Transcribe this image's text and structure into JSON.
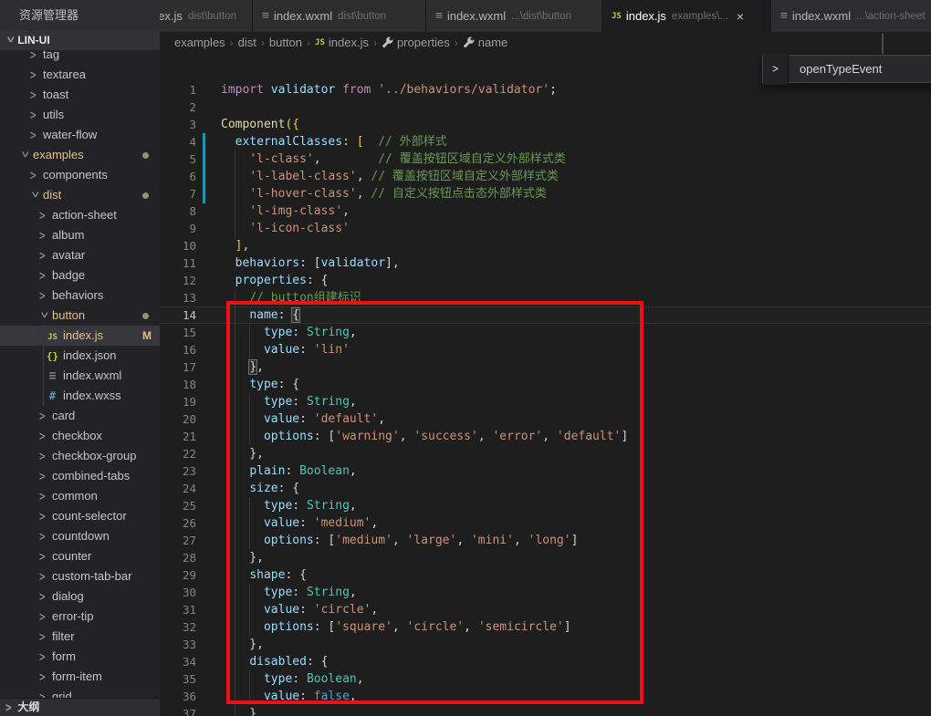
{
  "explorer": {
    "title": "资源管理器",
    "root": "LIN-UI",
    "outline": "大纲",
    "items": [
      {
        "k": "folder",
        "lvl": 2,
        "label": "tag"
      },
      {
        "k": "folder",
        "lvl": 2,
        "label": "textarea"
      },
      {
        "k": "folder",
        "lvl": 2,
        "label": "toast"
      },
      {
        "k": "folder",
        "lvl": 2,
        "label": "utils"
      },
      {
        "k": "folder",
        "lvl": 2,
        "label": "water-flow"
      },
      {
        "k": "folder",
        "lvl": 1,
        "label": "examples",
        "open": true,
        "dot": true,
        "mod": true
      },
      {
        "k": "folder",
        "lvl": 2,
        "label": "components"
      },
      {
        "k": "folder",
        "lvl": 2,
        "label": "dist",
        "open": true,
        "dot": true,
        "mod": true
      },
      {
        "k": "folder",
        "lvl": 3,
        "label": "action-sheet"
      },
      {
        "k": "folder",
        "lvl": 3,
        "label": "album"
      },
      {
        "k": "folder",
        "lvl": 3,
        "label": "avatar"
      },
      {
        "k": "folder",
        "lvl": 3,
        "label": "badge"
      },
      {
        "k": "folder",
        "lvl": 3,
        "label": "behaviors"
      },
      {
        "k": "folder",
        "lvl": 3,
        "label": "button",
        "open": true,
        "dot": true,
        "mod": true
      },
      {
        "k": "file",
        "lvl": 4,
        "icon": "js",
        "label": "index.js",
        "sel": true,
        "badge": "M",
        "mod": true
      },
      {
        "k": "file",
        "lvl": 4,
        "icon": "json",
        "label": "index.json"
      },
      {
        "k": "file",
        "lvl": 4,
        "icon": "wxml",
        "label": "index.wxml"
      },
      {
        "k": "file",
        "lvl": 4,
        "icon": "wxss",
        "label": "index.wxss"
      },
      {
        "k": "folder",
        "lvl": 3,
        "label": "card"
      },
      {
        "k": "folder",
        "lvl": 3,
        "label": "checkbox"
      },
      {
        "k": "folder",
        "lvl": 3,
        "label": "checkbox-group"
      },
      {
        "k": "folder",
        "lvl": 3,
        "label": "combined-tabs"
      },
      {
        "k": "folder",
        "lvl": 3,
        "label": "common"
      },
      {
        "k": "folder",
        "lvl": 3,
        "label": "count-selector"
      },
      {
        "k": "folder",
        "lvl": 3,
        "label": "countdown"
      },
      {
        "k": "folder",
        "lvl": 3,
        "label": "counter"
      },
      {
        "k": "folder",
        "lvl": 3,
        "label": "custom-tab-bar"
      },
      {
        "k": "folder",
        "lvl": 3,
        "label": "dialog"
      },
      {
        "k": "folder",
        "lvl": 3,
        "label": "error-tip"
      },
      {
        "k": "folder",
        "lvl": 3,
        "label": "filter"
      },
      {
        "k": "folder",
        "lvl": 3,
        "label": "form"
      },
      {
        "k": "folder",
        "lvl": 3,
        "label": "form-item"
      },
      {
        "k": "folder",
        "lvl": 3,
        "label": "grid"
      }
    ]
  },
  "tabs": [
    {
      "icon": "js",
      "label": "index.js",
      "path": "dist\\button",
      "active": false,
      "clipped": true
    },
    {
      "icon": "wxml",
      "label": "index.wxml",
      "path": "dist\\button",
      "active": false
    },
    {
      "icon": "wxml",
      "label": "index.wxml",
      "path": "...\\dist\\button",
      "active": false
    },
    {
      "icon": "js",
      "label": "index.js",
      "path": "examples\\...",
      "active": true,
      "close": "×"
    },
    {
      "icon": "wxml",
      "label": "index.wxml",
      "path": "...\\action-sheet",
      "active": false,
      "group2": true
    }
  ],
  "breadcrumb": [
    {
      "label": "examples"
    },
    {
      "label": "dist"
    },
    {
      "label": "button"
    },
    {
      "icon": "js",
      "label": "index.js"
    },
    {
      "icon": "wrench",
      "label": "properties"
    },
    {
      "icon": "wrench",
      "label": "name"
    }
  ],
  "popup": {
    "label": "openTypeEvent"
  },
  "editor": {
    "current_line": 14,
    "lines": [
      {
        "n": 1,
        "s": [
          [
            "kw",
            "import "
          ],
          [
            "vr",
            "validator "
          ],
          [
            "kw",
            "from "
          ],
          [
            "str",
            "'../behaviors/validator'"
          ],
          [
            "pu",
            ";"
          ]
        ]
      },
      {
        "n": 2,
        "s": []
      },
      {
        "n": 3,
        "s": [
          [
            "fn",
            "Component"
          ],
          [
            "gd",
            "({"
          ]
        ]
      },
      {
        "n": 4,
        "s": [
          [
            "pu",
            "  "
          ],
          [
            "vr",
            "externalClasses"
          ],
          [
            "pu",
            ": "
          ],
          [
            "gd",
            "["
          ],
          [
            "pu",
            "  "
          ],
          [
            "cm",
            "// 外部样式"
          ]
        ]
      },
      {
        "n": 5,
        "s": [
          [
            "pu",
            "    "
          ],
          [
            "str",
            "'l-class'"
          ],
          [
            "pu",
            ",        "
          ],
          [
            "cm",
            "// 覆盖按钮区域自定义外部样式类"
          ]
        ]
      },
      {
        "n": 6,
        "s": [
          [
            "pu",
            "    "
          ],
          [
            "str",
            "'l-label-class'"
          ],
          [
            "pu",
            ", "
          ],
          [
            "cm",
            "// 覆盖按钮区域自定义外部样式类"
          ]
        ]
      },
      {
        "n": 7,
        "s": [
          [
            "pu",
            "    "
          ],
          [
            "str",
            "'l-hover-class'"
          ],
          [
            "pu",
            ", "
          ],
          [
            "cm",
            "// 自定义按钮点击态外部样式类"
          ]
        ]
      },
      {
        "n": 8,
        "s": [
          [
            "pu",
            "    "
          ],
          [
            "str",
            "'l-img-class'"
          ],
          [
            "pu",
            ","
          ]
        ]
      },
      {
        "n": 9,
        "s": [
          [
            "pu",
            "    "
          ],
          [
            "str",
            "'l-icon-class'"
          ]
        ]
      },
      {
        "n": 10,
        "s": [
          [
            "pu",
            "  "
          ],
          [
            "gd",
            "]"
          ],
          [
            "pu",
            ","
          ]
        ]
      },
      {
        "n": 11,
        "s": [
          [
            "pu",
            "  "
          ],
          [
            "vr",
            "behaviors"
          ],
          [
            "pu",
            ": ["
          ],
          [
            "vr",
            "validator"
          ],
          [
            "pu",
            "],"
          ]
        ]
      },
      {
        "n": 12,
        "s": [
          [
            "pu",
            "  "
          ],
          [
            "vr",
            "properties"
          ],
          [
            "pu",
            ": {"
          ]
        ]
      },
      {
        "n": 13,
        "s": [
          [
            "pu",
            "    "
          ],
          [
            "cm",
            "// button组建标识"
          ]
        ]
      },
      {
        "n": 14,
        "s": [
          [
            "pu",
            "    "
          ],
          [
            "vr",
            "name"
          ],
          [
            "pu",
            ": "
          ],
          [
            "bm",
            "{"
          ]
        ]
      },
      {
        "n": 15,
        "s": [
          [
            "pu",
            "      "
          ],
          [
            "vr",
            "type"
          ],
          [
            "pu",
            ": "
          ],
          [
            "ty",
            "String"
          ],
          [
            "pu",
            ","
          ]
        ]
      },
      {
        "n": 16,
        "s": [
          [
            "pu",
            "      "
          ],
          [
            "vr",
            "value"
          ],
          [
            "pu",
            ": "
          ],
          [
            "str",
            "'lin'"
          ]
        ]
      },
      {
        "n": 17,
        "s": [
          [
            "pu",
            "    "
          ],
          [
            "bm",
            "}"
          ],
          [
            "pu",
            ","
          ]
        ]
      },
      {
        "n": 18,
        "s": [
          [
            "pu",
            "    "
          ],
          [
            "vr",
            "type"
          ],
          [
            "pu",
            ": {"
          ]
        ]
      },
      {
        "n": 19,
        "s": [
          [
            "pu",
            "      "
          ],
          [
            "vr",
            "type"
          ],
          [
            "pu",
            ": "
          ],
          [
            "ty",
            "String"
          ],
          [
            "pu",
            ","
          ]
        ]
      },
      {
        "n": 20,
        "s": [
          [
            "pu",
            "      "
          ],
          [
            "vr",
            "value"
          ],
          [
            "pu",
            ": "
          ],
          [
            "str",
            "'default'"
          ],
          [
            "pu",
            ","
          ]
        ]
      },
      {
        "n": 21,
        "s": [
          [
            "pu",
            "      "
          ],
          [
            "vr",
            "options"
          ],
          [
            "pu",
            ": ["
          ],
          [
            "str",
            "'warning'"
          ],
          [
            "pu",
            ", "
          ],
          [
            "str",
            "'success'"
          ],
          [
            "pu",
            ", "
          ],
          [
            "str",
            "'error'"
          ],
          [
            "pu",
            ", "
          ],
          [
            "str",
            "'default'"
          ],
          [
            "pu",
            "]"
          ]
        ]
      },
      {
        "n": 22,
        "s": [
          [
            "pu",
            "    },"
          ]
        ]
      },
      {
        "n": 23,
        "s": [
          [
            "pu",
            "    "
          ],
          [
            "vr",
            "plain"
          ],
          [
            "pu",
            ": "
          ],
          [
            "ty",
            "Boolean"
          ],
          [
            "pu",
            ","
          ]
        ]
      },
      {
        "n": 24,
        "s": [
          [
            "pu",
            "    "
          ],
          [
            "vr",
            "size"
          ],
          [
            "pu",
            ": {"
          ]
        ]
      },
      {
        "n": 25,
        "s": [
          [
            "pu",
            "      "
          ],
          [
            "vr",
            "type"
          ],
          [
            "pu",
            ": "
          ],
          [
            "ty",
            "String"
          ],
          [
            "pu",
            ","
          ]
        ]
      },
      {
        "n": 26,
        "s": [
          [
            "pu",
            "      "
          ],
          [
            "vr",
            "value"
          ],
          [
            "pu",
            ": "
          ],
          [
            "str",
            "'medium'"
          ],
          [
            "pu",
            ","
          ]
        ]
      },
      {
        "n": 27,
        "s": [
          [
            "pu",
            "      "
          ],
          [
            "vr",
            "options"
          ],
          [
            "pu",
            ": ["
          ],
          [
            "str",
            "'medium'"
          ],
          [
            "pu",
            ", "
          ],
          [
            "str",
            "'large'"
          ],
          [
            "pu",
            ", "
          ],
          [
            "str",
            "'mini'"
          ],
          [
            "pu",
            ", "
          ],
          [
            "str",
            "'long'"
          ],
          [
            "pu",
            "]"
          ]
        ]
      },
      {
        "n": 28,
        "s": [
          [
            "pu",
            "    },"
          ]
        ]
      },
      {
        "n": 29,
        "s": [
          [
            "pu",
            "    "
          ],
          [
            "vr",
            "shape"
          ],
          [
            "pu",
            ": {"
          ]
        ]
      },
      {
        "n": 30,
        "s": [
          [
            "pu",
            "      "
          ],
          [
            "vr",
            "type"
          ],
          [
            "pu",
            ": "
          ],
          [
            "ty",
            "String"
          ],
          [
            "pu",
            ","
          ]
        ]
      },
      {
        "n": 31,
        "s": [
          [
            "pu",
            "      "
          ],
          [
            "vr",
            "value"
          ],
          [
            "pu",
            ": "
          ],
          [
            "str",
            "'circle'"
          ],
          [
            "pu",
            ","
          ]
        ]
      },
      {
        "n": 32,
        "s": [
          [
            "pu",
            "      "
          ],
          [
            "vr",
            "options"
          ],
          [
            "pu",
            ": ["
          ],
          [
            "str",
            "'square'"
          ],
          [
            "pu",
            ", "
          ],
          [
            "str",
            "'circle'"
          ],
          [
            "pu",
            ", "
          ],
          [
            "str",
            "'semicircle'"
          ],
          [
            "pu",
            "]"
          ]
        ]
      },
      {
        "n": 33,
        "s": [
          [
            "pu",
            "    },"
          ]
        ]
      },
      {
        "n": 34,
        "s": [
          [
            "pu",
            "    "
          ],
          [
            "vr",
            "disabled"
          ],
          [
            "pu",
            ": {"
          ]
        ]
      },
      {
        "n": 35,
        "s": [
          [
            "pu",
            "      "
          ],
          [
            "vr",
            "type"
          ],
          [
            "pu",
            ": "
          ],
          [
            "ty",
            "Boolean"
          ],
          [
            "pu",
            ","
          ]
        ]
      },
      {
        "n": 36,
        "s": [
          [
            "pu",
            "      "
          ],
          [
            "vr",
            "value"
          ],
          [
            "pu",
            ": "
          ],
          [
            "cn",
            "false"
          ],
          [
            "pu",
            ","
          ]
        ]
      },
      {
        "n": 37,
        "s": [
          [
            "pu",
            "    }"
          ]
        ]
      }
    ]
  },
  "colors": {
    "annotation_red": "#ee1111",
    "git_modified": "#e2c08d",
    "git_gutter_modified": "#1f96ad",
    "editor_bg": "#1e1e1e",
    "js_icon": "#cbcb41",
    "wxss_icon": "#519aba"
  }
}
